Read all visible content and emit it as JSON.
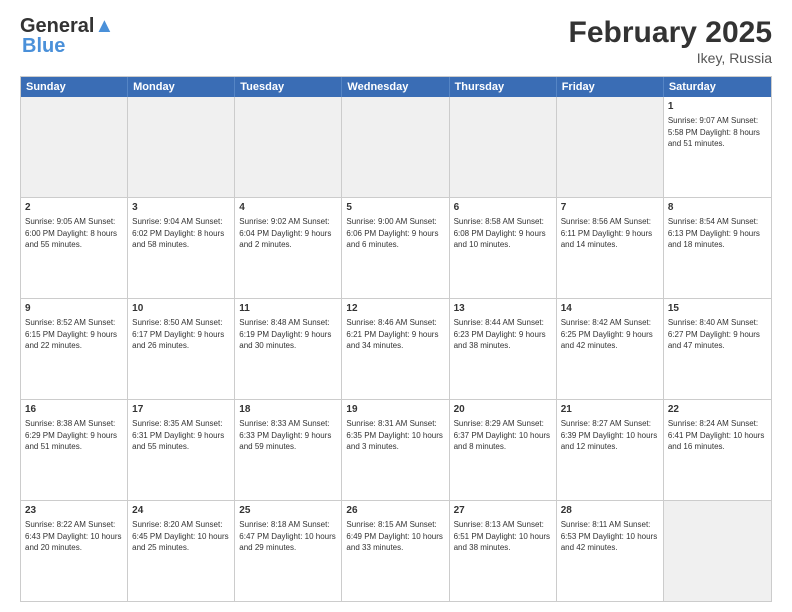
{
  "header": {
    "logo_general": "General",
    "logo_blue": "Blue",
    "month_title": "February 2025",
    "location": "Ikey, Russia"
  },
  "days_of_week": [
    "Sunday",
    "Monday",
    "Tuesday",
    "Wednesday",
    "Thursday",
    "Friday",
    "Saturday"
  ],
  "weeks": [
    [
      {
        "day": "",
        "info": "",
        "shaded": true
      },
      {
        "day": "",
        "info": "",
        "shaded": true
      },
      {
        "day": "",
        "info": "",
        "shaded": true
      },
      {
        "day": "",
        "info": "",
        "shaded": true
      },
      {
        "day": "",
        "info": "",
        "shaded": true
      },
      {
        "day": "",
        "info": "",
        "shaded": true
      },
      {
        "day": "1",
        "info": "Sunrise: 9:07 AM\nSunset: 5:58 PM\nDaylight: 8 hours and 51 minutes.",
        "shaded": false
      }
    ],
    [
      {
        "day": "2",
        "info": "Sunrise: 9:05 AM\nSunset: 6:00 PM\nDaylight: 8 hours and 55 minutes.",
        "shaded": false
      },
      {
        "day": "3",
        "info": "Sunrise: 9:04 AM\nSunset: 6:02 PM\nDaylight: 8 hours and 58 minutes.",
        "shaded": false
      },
      {
        "day": "4",
        "info": "Sunrise: 9:02 AM\nSunset: 6:04 PM\nDaylight: 9 hours and 2 minutes.",
        "shaded": false
      },
      {
        "day": "5",
        "info": "Sunrise: 9:00 AM\nSunset: 6:06 PM\nDaylight: 9 hours and 6 minutes.",
        "shaded": false
      },
      {
        "day": "6",
        "info": "Sunrise: 8:58 AM\nSunset: 6:08 PM\nDaylight: 9 hours and 10 minutes.",
        "shaded": false
      },
      {
        "day": "7",
        "info": "Sunrise: 8:56 AM\nSunset: 6:11 PM\nDaylight: 9 hours and 14 minutes.",
        "shaded": false
      },
      {
        "day": "8",
        "info": "Sunrise: 8:54 AM\nSunset: 6:13 PM\nDaylight: 9 hours and 18 minutes.",
        "shaded": false
      }
    ],
    [
      {
        "day": "9",
        "info": "Sunrise: 8:52 AM\nSunset: 6:15 PM\nDaylight: 9 hours and 22 minutes.",
        "shaded": false
      },
      {
        "day": "10",
        "info": "Sunrise: 8:50 AM\nSunset: 6:17 PM\nDaylight: 9 hours and 26 minutes.",
        "shaded": false
      },
      {
        "day": "11",
        "info": "Sunrise: 8:48 AM\nSunset: 6:19 PM\nDaylight: 9 hours and 30 minutes.",
        "shaded": false
      },
      {
        "day": "12",
        "info": "Sunrise: 8:46 AM\nSunset: 6:21 PM\nDaylight: 9 hours and 34 minutes.",
        "shaded": false
      },
      {
        "day": "13",
        "info": "Sunrise: 8:44 AM\nSunset: 6:23 PM\nDaylight: 9 hours and 38 minutes.",
        "shaded": false
      },
      {
        "day": "14",
        "info": "Sunrise: 8:42 AM\nSunset: 6:25 PM\nDaylight: 9 hours and 42 minutes.",
        "shaded": false
      },
      {
        "day": "15",
        "info": "Sunrise: 8:40 AM\nSunset: 6:27 PM\nDaylight: 9 hours and 47 minutes.",
        "shaded": false
      }
    ],
    [
      {
        "day": "16",
        "info": "Sunrise: 8:38 AM\nSunset: 6:29 PM\nDaylight: 9 hours and 51 minutes.",
        "shaded": false
      },
      {
        "day": "17",
        "info": "Sunrise: 8:35 AM\nSunset: 6:31 PM\nDaylight: 9 hours and 55 minutes.",
        "shaded": false
      },
      {
        "day": "18",
        "info": "Sunrise: 8:33 AM\nSunset: 6:33 PM\nDaylight: 9 hours and 59 minutes.",
        "shaded": false
      },
      {
        "day": "19",
        "info": "Sunrise: 8:31 AM\nSunset: 6:35 PM\nDaylight: 10 hours and 3 minutes.",
        "shaded": false
      },
      {
        "day": "20",
        "info": "Sunrise: 8:29 AM\nSunset: 6:37 PM\nDaylight: 10 hours and 8 minutes.",
        "shaded": false
      },
      {
        "day": "21",
        "info": "Sunrise: 8:27 AM\nSunset: 6:39 PM\nDaylight: 10 hours and 12 minutes.",
        "shaded": false
      },
      {
        "day": "22",
        "info": "Sunrise: 8:24 AM\nSunset: 6:41 PM\nDaylight: 10 hours and 16 minutes.",
        "shaded": false
      }
    ],
    [
      {
        "day": "23",
        "info": "Sunrise: 8:22 AM\nSunset: 6:43 PM\nDaylight: 10 hours and 20 minutes.",
        "shaded": false
      },
      {
        "day": "24",
        "info": "Sunrise: 8:20 AM\nSunset: 6:45 PM\nDaylight: 10 hours and 25 minutes.",
        "shaded": false
      },
      {
        "day": "25",
        "info": "Sunrise: 8:18 AM\nSunset: 6:47 PM\nDaylight: 10 hours and 29 minutes.",
        "shaded": false
      },
      {
        "day": "26",
        "info": "Sunrise: 8:15 AM\nSunset: 6:49 PM\nDaylight: 10 hours and 33 minutes.",
        "shaded": false
      },
      {
        "day": "27",
        "info": "Sunrise: 8:13 AM\nSunset: 6:51 PM\nDaylight: 10 hours and 38 minutes.",
        "shaded": false
      },
      {
        "day": "28",
        "info": "Sunrise: 8:11 AM\nSunset: 6:53 PM\nDaylight: 10 hours and 42 minutes.",
        "shaded": false
      },
      {
        "day": "",
        "info": "",
        "shaded": true
      }
    ]
  ]
}
